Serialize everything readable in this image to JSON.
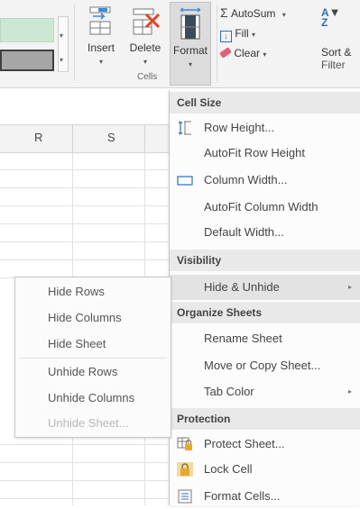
{
  "ribbon": {
    "insert_label": "Insert",
    "delete_label": "Delete",
    "format_label": "Format",
    "cells_group_label": "Cells",
    "autosum_label": "AutoSum",
    "fill_label": "Fill",
    "clear_label": "Clear",
    "sort_label": "Sort &",
    "filter_label": "Filter",
    "dropdown_caret": "▾"
  },
  "grid": {
    "columns": [
      "R",
      "S"
    ]
  },
  "menu": {
    "sections": {
      "cell_size": "Cell Size",
      "visibility": "Visibility",
      "organize_sheets": "Organize Sheets",
      "protection": "Protection"
    },
    "items": {
      "row_height": "Row Height...",
      "autofit_row_height": "AutoFit Row Height",
      "column_width": "Column Width...",
      "autofit_column_width": "AutoFit Column Width",
      "default_width": "Default Width...",
      "hide_unhide": "Hide & Unhide",
      "rename_sheet": "Rename Sheet",
      "move_copy_sheet": "Move or Copy Sheet...",
      "tab_color": "Tab Color",
      "protect_sheet": "Protect Sheet...",
      "lock_cell": "Lock Cell",
      "format_cells": "Format Cells..."
    },
    "submenu_arrow": "▸"
  },
  "submenu": {
    "hide_rows": "Hide Rows",
    "hide_columns": "Hide Columns",
    "hide_sheet": "Hide Sheet",
    "unhide_rows": "Unhide Rows",
    "unhide_columns": "Unhide Columns",
    "unhide_sheet": "Unhide Sheet..."
  },
  "colors": {
    "style_green": "#cde8d2",
    "menu_highlight": "#e3e3e3",
    "section_header_bg": "#e9e9e9"
  }
}
